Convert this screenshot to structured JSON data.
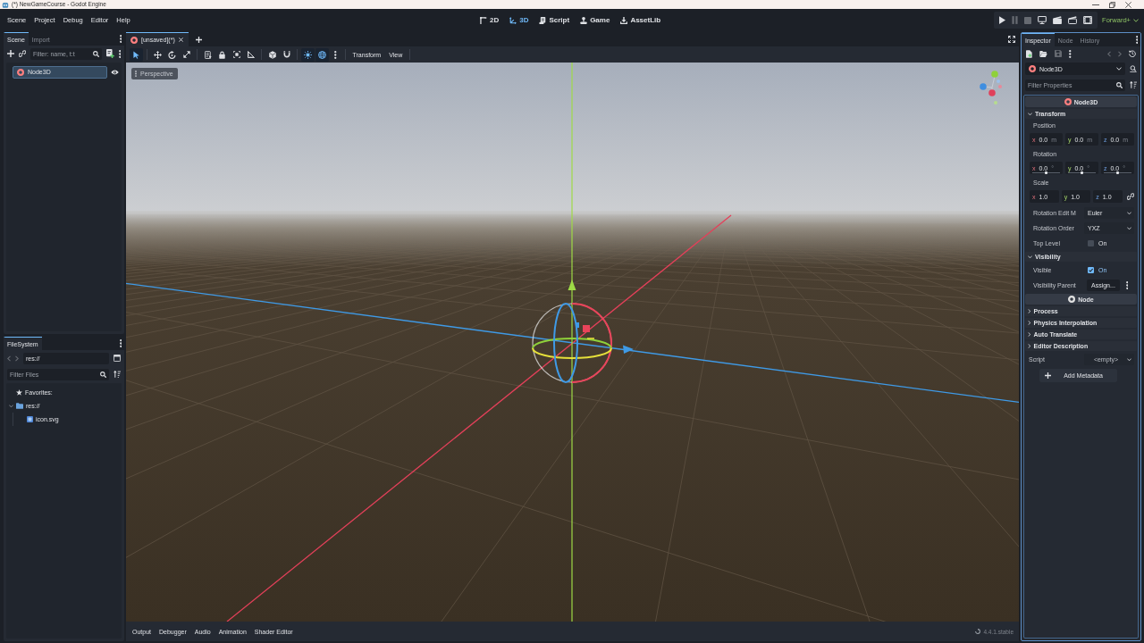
{
  "window": {
    "title": "(*) NewGameCourse - Godot Engine"
  },
  "menu": [
    "Scene",
    "Project",
    "Debug",
    "Editor",
    "Help"
  ],
  "workspaces": [
    {
      "kind": "canvas",
      "label": "2D",
      "selected": false
    },
    {
      "kind": "spatial",
      "label": "3D",
      "selected": true
    },
    {
      "kind": "script",
      "label": "Script",
      "selected": false
    },
    {
      "kind": "game",
      "label": "Game",
      "selected": false
    },
    {
      "kind": "assetlib",
      "label": "AssetLib",
      "selected": false
    }
  ],
  "run_bar": {
    "buttons": [
      {
        "kind": "play",
        "disabled": false
      },
      {
        "kind": "pause",
        "disabled": true
      },
      {
        "kind": "stop",
        "disabled": true
      },
      {
        "kind": "remote",
        "disabled": false
      },
      {
        "kind": "current",
        "disabled": false
      },
      {
        "kind": "custom",
        "disabled": false
      },
      {
        "kind": "movie",
        "disabled": false
      }
    ],
    "renderer": "Forward+"
  },
  "scene_dock": {
    "tabs": [
      {
        "label": "Scene",
        "selected": true
      },
      {
        "label": "Import",
        "selected": false
      }
    ],
    "filter": {
      "placeholder": "Filter: name, t:t"
    },
    "nodes": [
      {
        "label": "Node3D",
        "selected": true,
        "visible": true
      }
    ]
  },
  "filesystem": {
    "tabs": [
      {
        "label": "FileSystem",
        "selected": true
      }
    ],
    "nav": [
      {
        "kind": "back",
        "disabled": true
      },
      {
        "kind": "forward",
        "disabled": true
      }
    ],
    "path": "res://",
    "filter": {
      "placeholder": "Filter Files"
    },
    "tree": [
      {
        "kind": "favorites",
        "label": "Favorites:"
      },
      {
        "kind": "folder",
        "label": "res://",
        "expanded": true,
        "children": [
          {
            "kind": "image",
            "label": "icon.svg"
          }
        ]
      }
    ]
  },
  "editor": {
    "tabs": [
      {
        "label": "[unsaved](*)",
        "selected": true
      }
    ],
    "tool_groups": [
      [
        {
          "kind": "select",
          "on": true
        }
      ],
      [
        {
          "kind": "move",
          "on": false
        },
        {
          "kind": "rotate",
          "on": false
        },
        {
          "kind": "scale",
          "on": false
        }
      ],
      [
        {
          "kind": "list",
          "on": false
        },
        {
          "kind": "lock",
          "on": false
        },
        {
          "kind": "group",
          "on": false
        },
        {
          "kind": "ruler",
          "on": false
        }
      ],
      [
        {
          "kind": "local",
          "on": false
        },
        {
          "kind": "snap",
          "on": false
        }
      ],
      [
        {
          "kind": "sun",
          "on": true
        },
        {
          "kind": "environment",
          "on": true
        }
      ]
    ],
    "menus": [
      "Transform",
      "View"
    ],
    "viewport": {
      "view": "Perspective"
    }
  },
  "bottom_panel": {
    "tabs": [
      {
        "label": "Output",
        "selected": false
      },
      {
        "label": "Debugger",
        "selected": false
      },
      {
        "label": "Audio",
        "selected": false
      },
      {
        "label": "Animation",
        "selected": false
      },
      {
        "label": "Shader Editor",
        "selected": false
      }
    ],
    "version": "4.4.1.stable"
  },
  "inspector": {
    "tabs": [
      {
        "label": "Inspector",
        "selected": true
      },
      {
        "label": "Node",
        "selected": false
      },
      {
        "label": "History",
        "selected": false
      }
    ],
    "toolbar": [
      {
        "kind": "new",
        "disabled": false
      },
      {
        "kind": "open",
        "disabled": false
      },
      {
        "kind": "save",
        "disabled": true
      },
      {
        "kind": "more",
        "disabled": false
      }
    ],
    "history_nav": [
      {
        "kind": "back",
        "disabled": true
      },
      {
        "kind": "forward",
        "disabled": true
      },
      {
        "kind": "history",
        "disabled": false
      }
    ],
    "object": "Node3D",
    "filter": {
      "placeholder": "Filter Properties"
    },
    "classes": [
      {
        "label": "Node3D",
        "color": "#fc7f7f",
        "sections": [
          {
            "label": "Transform",
            "expanded": true,
            "properties": [
              {
                "kind": "vector",
                "label": "Position",
                "fields": [
                  {
                    "axis": "x",
                    "value": "0.0",
                    "unit": "m"
                  },
                  {
                    "axis": "y",
                    "value": "0.0",
                    "unit": "m"
                  },
                  {
                    "axis": "z",
                    "value": "0.0",
                    "unit": "m"
                  }
                ]
              },
              {
                "kind": "angles",
                "label": "Rotation",
                "fields": [
                  {
                    "axis": "x",
                    "value": "0.0",
                    "unit": "°",
                    "level": 0.5
                  },
                  {
                    "axis": "y",
                    "value": "0.0",
                    "unit": "°",
                    "level": 0.5
                  },
                  {
                    "axis": "z",
                    "value": "0.0",
                    "unit": "°",
                    "level": 0.5
                  }
                ]
              },
              {
                "kind": "linked",
                "label": "Scale",
                "fields": [
                  {
                    "axis": "x",
                    "value": "1.0"
                  },
                  {
                    "axis": "y",
                    "value": "1.0"
                  },
                  {
                    "axis": "z",
                    "value": "1.0"
                  }
                ]
              },
              {
                "kind": "enum",
                "label": "Rotation Edit M",
                "value": "Euler"
              },
              {
                "kind": "enum",
                "label": "Rotation Order",
                "value": "YXZ"
              },
              {
                "kind": "bool",
                "label": "Top Level",
                "text": "On",
                "checked": false
              }
            ]
          },
          {
            "label": "Visibility",
            "expanded": true,
            "properties": [
              {
                "kind": "bool",
                "label": "Visible",
                "text": "On",
                "checked": true
              },
              {
                "kind": "object",
                "label": "Visibility Parent",
                "value": "Assign..."
              }
            ]
          }
        ]
      },
      {
        "label": "Node",
        "color": "#e0e0e0",
        "sections": [
          {
            "label": "Process",
            "expanded": false
          },
          {
            "label": "Physics Interpolation",
            "expanded": false
          },
          {
            "label": "Auto Translate",
            "expanded": false
          },
          {
            "label": "Editor Description",
            "expanded": false
          }
        ]
      }
    ],
    "script": {
      "label": "Script",
      "value": "<empty>"
    },
    "add_button": "Add Metadata"
  }
}
